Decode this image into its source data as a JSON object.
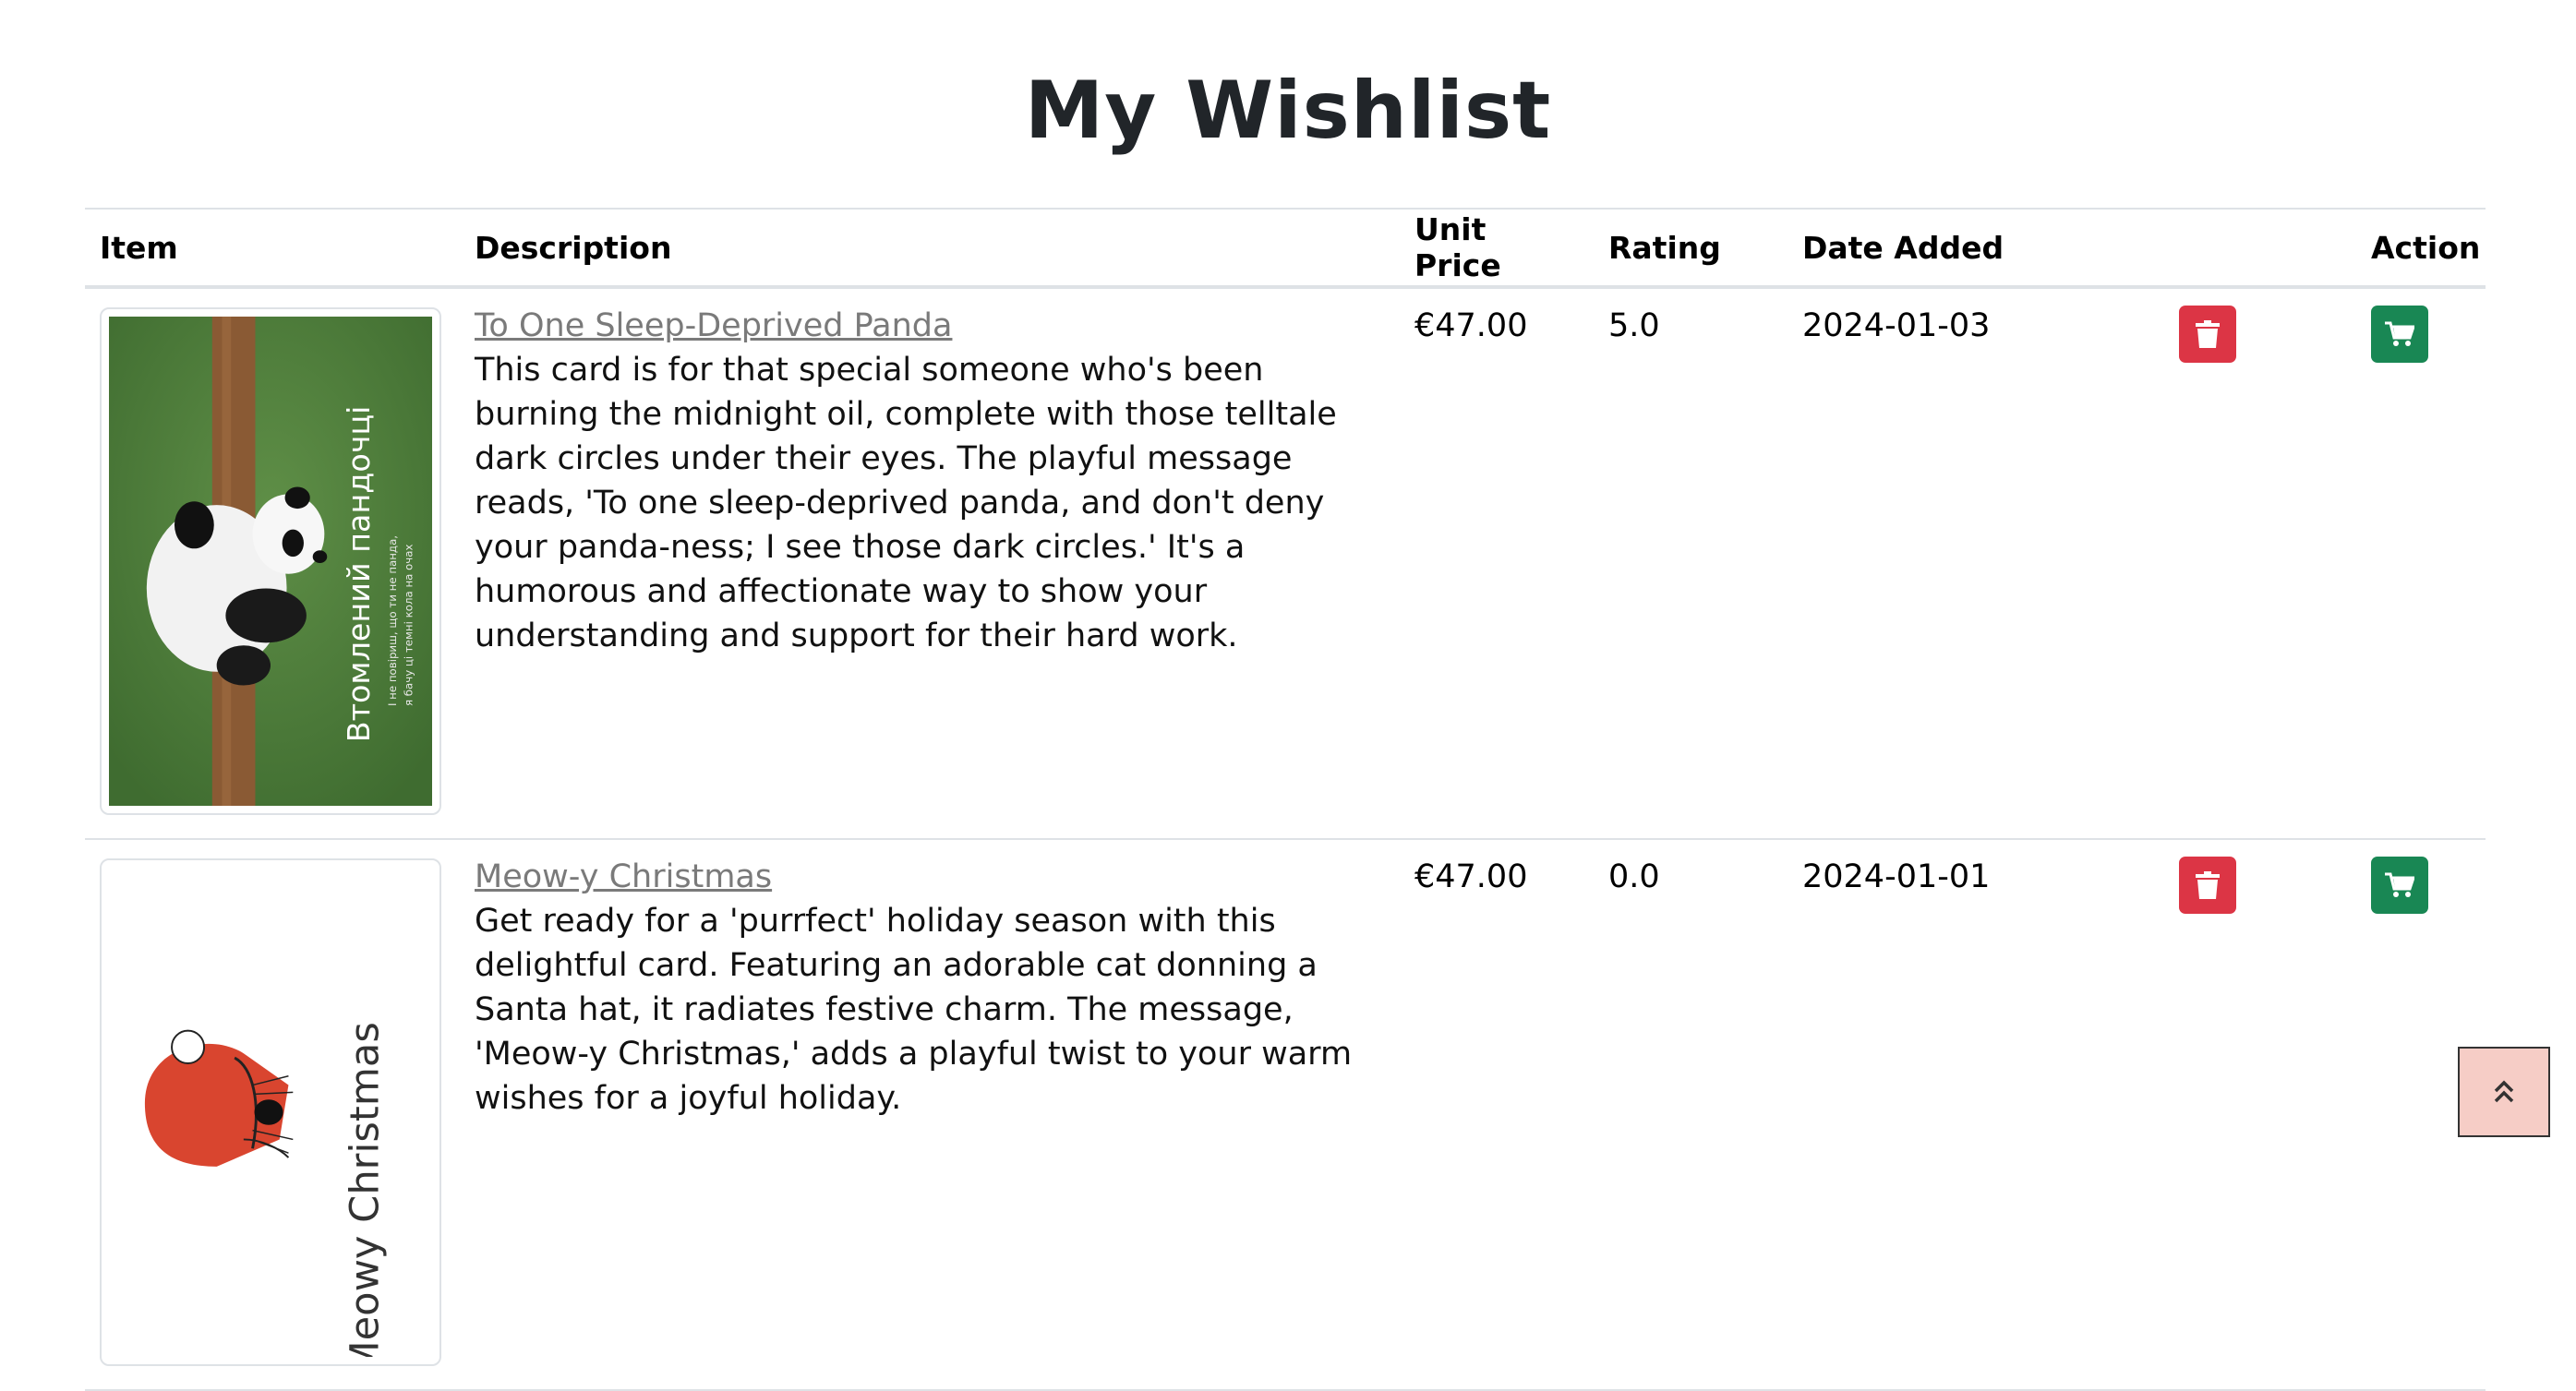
{
  "page": {
    "title": "My Wishlist"
  },
  "table": {
    "headers": {
      "item": "Item",
      "description": "Description",
      "unit_price": "Unit Price",
      "rating": "Rating",
      "date_added": "Date Added",
      "delete": "",
      "action": "Action"
    },
    "rows": [
      {
        "title": "To One Sleep-Deprived Panda",
        "description": "This card is for that special someone who's been burning the midnight oil, complete with those telltale dark circles under their eyes. The playful message reads, 'To one sleep-deprived panda, and don't deny your panda-ness; I see those dark circles.' It's a humorous and affectionate way to show your understanding and support for their hard work.",
        "price": "€47.00",
        "rating": "5.0",
        "date_added": "2024-01-03",
        "image": {
          "text": "Втомлений пандочці",
          "subtext_1": "І не повіриш, що ти не панда,",
          "subtext_2": "я бачу ці темні кола на очах"
        }
      },
      {
        "title": "Meow-y Christmas",
        "description": "Get ready for a 'purrfect' holiday season with this delightful card. Featuring an adorable cat donning a Santa hat, it radiates festive charm. The message, 'Meow-y Christmas,' adds a playful twist to your warm wishes for a joyful holiday.",
        "price": "€47.00",
        "rating": "0.0",
        "date_added": "2024-01-01",
        "image": {
          "text": "Meowy Christmas"
        }
      }
    ]
  },
  "icons": {
    "delete": "trash-icon",
    "cart": "shopping-cart-icon",
    "back_to_top": "double-chevron-up-icon"
  },
  "colors": {
    "delete": "#dc3545",
    "cart": "#198754",
    "back_to_top_bg": "#f6cdc6",
    "link": "#7a7a7a",
    "border": "#dee2e6"
  }
}
